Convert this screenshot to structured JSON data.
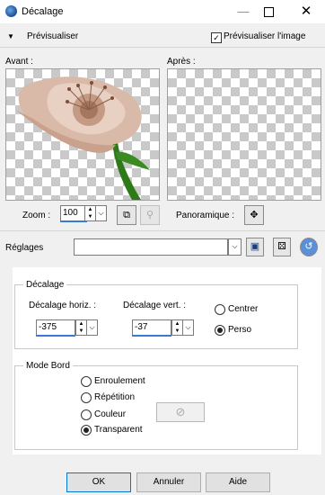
{
  "window": {
    "title": "Décalage",
    "minimize": "—",
    "close": "✕"
  },
  "preview": {
    "toggle_label": "Prévisualiser",
    "checkbox_label": "Prévisualiser l'image",
    "checkbox_checked": true,
    "before_label": "Avant :",
    "after_label": "Après :"
  },
  "zoom": {
    "label": "Zoom :",
    "value": "100"
  },
  "panoramique": {
    "label": "Panoramique :"
  },
  "reglages": {
    "label": "Réglages",
    "value": ""
  },
  "decalage": {
    "title": "Décalage",
    "horiz_label": "Décalage horiz. :",
    "horiz_value": "-375",
    "vert_label": "Décalage vert. :",
    "vert_value": "-37",
    "options": [
      "Centrer",
      "Perso"
    ],
    "selected": "Perso"
  },
  "mode_bord": {
    "title": "Mode Bord",
    "options": [
      "Enroulement",
      "Répétition",
      "Couleur",
      "Transparent"
    ],
    "selected": "Transparent"
  },
  "buttons": {
    "ok": "OK",
    "annuler": "Annuler",
    "aide": "Aide"
  },
  "icons": {
    "app": "offset-app-icon",
    "fit": "fit-to-window-icon",
    "magnify": "magnifier-icon",
    "pan": "pan-move-icon",
    "save": "save-icon",
    "dice": "randomize-dice-icon",
    "reset": "reset-icon",
    "no_color": "no-color-icon"
  },
  "colors": {
    "accent": "#3c78d8",
    "focus": "#0078d7"
  }
}
